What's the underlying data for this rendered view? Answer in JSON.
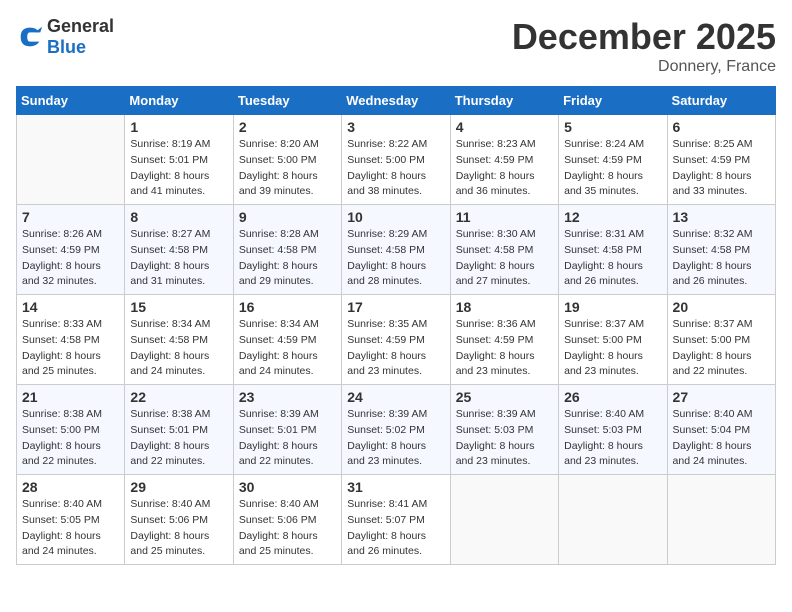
{
  "header": {
    "logo_general": "General",
    "logo_blue": "Blue",
    "month": "December 2025",
    "location": "Donnery, France"
  },
  "weekdays": [
    "Sunday",
    "Monday",
    "Tuesday",
    "Wednesday",
    "Thursday",
    "Friday",
    "Saturday"
  ],
  "weeks": [
    [
      {
        "day": "",
        "empty": true
      },
      {
        "day": "1",
        "sunrise": "8:19 AM",
        "sunset": "5:01 PM",
        "daylight": "8 hours and 41 minutes."
      },
      {
        "day": "2",
        "sunrise": "8:20 AM",
        "sunset": "5:00 PM",
        "daylight": "8 hours and 39 minutes."
      },
      {
        "day": "3",
        "sunrise": "8:22 AM",
        "sunset": "5:00 PM",
        "daylight": "8 hours and 38 minutes."
      },
      {
        "day": "4",
        "sunrise": "8:23 AM",
        "sunset": "4:59 PM",
        "daylight": "8 hours and 36 minutes."
      },
      {
        "day": "5",
        "sunrise": "8:24 AM",
        "sunset": "4:59 PM",
        "daylight": "8 hours and 35 minutes."
      },
      {
        "day": "6",
        "sunrise": "8:25 AM",
        "sunset": "4:59 PM",
        "daylight": "8 hours and 33 minutes."
      }
    ],
    [
      {
        "day": "7",
        "sunrise": "8:26 AM",
        "sunset": "4:59 PM",
        "daylight": "8 hours and 32 minutes."
      },
      {
        "day": "8",
        "sunrise": "8:27 AM",
        "sunset": "4:58 PM",
        "daylight": "8 hours and 31 minutes."
      },
      {
        "day": "9",
        "sunrise": "8:28 AM",
        "sunset": "4:58 PM",
        "daylight": "8 hours and 29 minutes."
      },
      {
        "day": "10",
        "sunrise": "8:29 AM",
        "sunset": "4:58 PM",
        "daylight": "8 hours and 28 minutes."
      },
      {
        "day": "11",
        "sunrise": "8:30 AM",
        "sunset": "4:58 PM",
        "daylight": "8 hours and 27 minutes."
      },
      {
        "day": "12",
        "sunrise": "8:31 AM",
        "sunset": "4:58 PM",
        "daylight": "8 hours and 26 minutes."
      },
      {
        "day": "13",
        "sunrise": "8:32 AM",
        "sunset": "4:58 PM",
        "daylight": "8 hours and 26 minutes."
      }
    ],
    [
      {
        "day": "14",
        "sunrise": "8:33 AM",
        "sunset": "4:58 PM",
        "daylight": "8 hours and 25 minutes."
      },
      {
        "day": "15",
        "sunrise": "8:34 AM",
        "sunset": "4:58 PM",
        "daylight": "8 hours and 24 minutes."
      },
      {
        "day": "16",
        "sunrise": "8:34 AM",
        "sunset": "4:59 PM",
        "daylight": "8 hours and 24 minutes."
      },
      {
        "day": "17",
        "sunrise": "8:35 AM",
        "sunset": "4:59 PM",
        "daylight": "8 hours and 23 minutes."
      },
      {
        "day": "18",
        "sunrise": "8:36 AM",
        "sunset": "4:59 PM",
        "daylight": "8 hours and 23 minutes."
      },
      {
        "day": "19",
        "sunrise": "8:37 AM",
        "sunset": "5:00 PM",
        "daylight": "8 hours and 23 minutes."
      },
      {
        "day": "20",
        "sunrise": "8:37 AM",
        "sunset": "5:00 PM",
        "daylight": "8 hours and 22 minutes."
      }
    ],
    [
      {
        "day": "21",
        "sunrise": "8:38 AM",
        "sunset": "5:00 PM",
        "daylight": "8 hours and 22 minutes."
      },
      {
        "day": "22",
        "sunrise": "8:38 AM",
        "sunset": "5:01 PM",
        "daylight": "8 hours and 22 minutes."
      },
      {
        "day": "23",
        "sunrise": "8:39 AM",
        "sunset": "5:01 PM",
        "daylight": "8 hours and 22 minutes."
      },
      {
        "day": "24",
        "sunrise": "8:39 AM",
        "sunset": "5:02 PM",
        "daylight": "8 hours and 23 minutes."
      },
      {
        "day": "25",
        "sunrise": "8:39 AM",
        "sunset": "5:03 PM",
        "daylight": "8 hours and 23 minutes."
      },
      {
        "day": "26",
        "sunrise": "8:40 AM",
        "sunset": "5:03 PM",
        "daylight": "8 hours and 23 minutes."
      },
      {
        "day": "27",
        "sunrise": "8:40 AM",
        "sunset": "5:04 PM",
        "daylight": "8 hours and 24 minutes."
      }
    ],
    [
      {
        "day": "28",
        "sunrise": "8:40 AM",
        "sunset": "5:05 PM",
        "daylight": "8 hours and 24 minutes."
      },
      {
        "day": "29",
        "sunrise": "8:40 AM",
        "sunset": "5:06 PM",
        "daylight": "8 hours and 25 minutes."
      },
      {
        "day": "30",
        "sunrise": "8:40 AM",
        "sunset": "5:06 PM",
        "daylight": "8 hours and 25 minutes."
      },
      {
        "day": "31",
        "sunrise": "8:41 AM",
        "sunset": "5:07 PM",
        "daylight": "8 hours and 26 minutes."
      },
      {
        "day": "",
        "empty": true
      },
      {
        "day": "",
        "empty": true
      },
      {
        "day": "",
        "empty": true
      }
    ]
  ]
}
